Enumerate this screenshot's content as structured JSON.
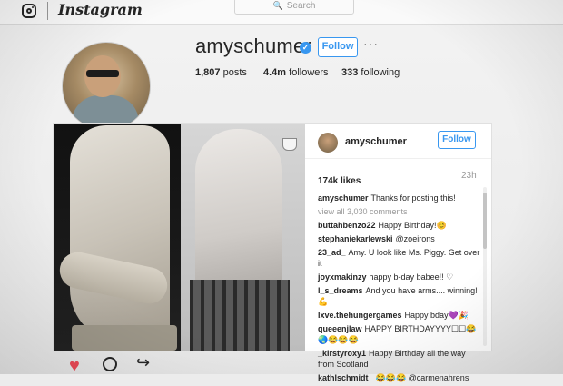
{
  "nav": {
    "brand": "Instagram",
    "search_placeholder": "Search",
    "icons": {
      "logo": "instagram-glyph-icon",
      "search": "magnifier-icon"
    }
  },
  "profile": {
    "username": "amyschumer",
    "verified_icon": "verified-badge-icon",
    "follow_label": "Follow",
    "more_icon": "more-options-icon",
    "posts_count": "1,807",
    "posts_label": "posts",
    "followers_count": "4.4m",
    "followers_label": "followers",
    "following_count": "333",
    "following_label": "following"
  },
  "post": {
    "username": "amyschumer",
    "follow_label": "Follow",
    "likes": "174k likes",
    "time": "23h",
    "comments": [
      {
        "user": "amyschumer",
        "text": "Thanks for posting this!"
      },
      {
        "user": "",
        "text": "view all 3,030 comments"
      },
      {
        "user": "buttahbenzo22",
        "text": "Happy Birthday!😊"
      },
      {
        "user": "stephaniekarlewski",
        "text": "@zoeirons"
      },
      {
        "user": "23_ad_",
        "text": "Amy. U look like Ms. Piggy. Get over it"
      },
      {
        "user": "joyxmakinzy",
        "text": "happy b-day babee!! ♡"
      },
      {
        "user": "l_s_dreams",
        "text": "And you have arms.... winning! 💪"
      },
      {
        "user": "lxve.thehungergames",
        "text": "Happy bday💜🎉"
      },
      {
        "user": "queeenjlaw",
        "text": "HAPPY BIRTHDAYYYY☐☐😂🌏😂😂😂"
      },
      {
        "user": "_kirstyroxy1",
        "text": "Happy Birthday all the way from Scotland"
      },
      {
        "user": "kathlschmidt_",
        "text": "😂😂😂 @carmenahrens"
      }
    ],
    "actions": {
      "like": "heart-icon",
      "comment": "comment-icon",
      "share": "share-icon"
    }
  },
  "colors": {
    "accent": "#3897f0",
    "like": "#ed4956",
    "text": "#262626",
    "muted": "#999999"
  }
}
